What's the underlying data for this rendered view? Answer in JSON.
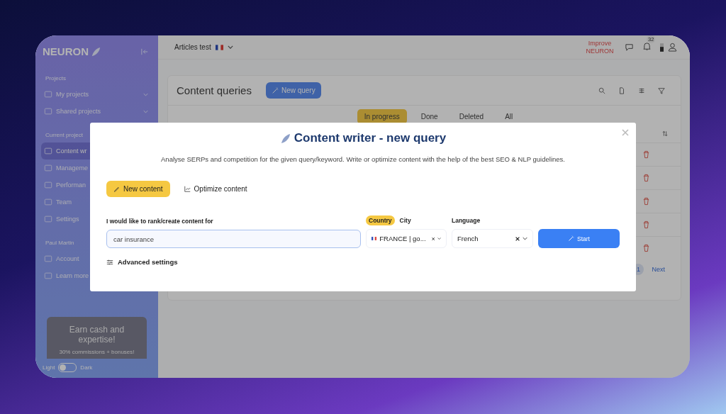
{
  "sidebar": {
    "logo": "NEURON",
    "sections": [
      {
        "title": "Projects",
        "items": [
          {
            "label": "My projects",
            "expandable": true,
            "selected": false
          },
          {
            "label": "Shared projects",
            "expandable": true,
            "selected": false
          }
        ]
      },
      {
        "title": "Current project",
        "items": [
          {
            "label": "Content wr",
            "selected": true
          },
          {
            "label": "Manageme",
            "selected": false
          },
          {
            "label": "Performan",
            "selected": false
          },
          {
            "label": "Team",
            "selected": false
          },
          {
            "label": "Settings",
            "selected": false
          }
        ]
      },
      {
        "title": "Paul Martin",
        "items": [
          {
            "label": "Account",
            "selected": false
          },
          {
            "label": "Learn more",
            "selected": false
          }
        ]
      }
    ],
    "promo": {
      "title": "Earn cash and expertise!",
      "subtitle": "30% commissions + bonuses!"
    },
    "theme": {
      "light": "Light",
      "dark": "Dark",
      "dark_on": false
    }
  },
  "topbar": {
    "project": "Articles test",
    "improve": "Improve NEURON",
    "notifications": "32"
  },
  "page": {
    "title": "Content queries",
    "new_button": "New query",
    "filters": [
      {
        "label": "In progress",
        "selected": true
      },
      {
        "label": "Done",
        "selected": false
      },
      {
        "label": "Deleted",
        "selected": false
      },
      {
        "label": "All",
        "selected": false
      }
    ],
    "pagination": {
      "pages": [
        {
          "label": "1",
          "selected": true
        }
      ],
      "next": "Next"
    }
  },
  "modal": {
    "title": "Content writer - new query",
    "description": "Analyse SERPs and competition for the given query/keyword. Write or optimize content with the help of the best SEO & NLP guidelines.",
    "modes": [
      {
        "label": "New content",
        "selected": true
      },
      {
        "label": "Optimize content",
        "selected": false
      }
    ],
    "query_label": "I would like to rank/create content for",
    "query_value": "car insurance",
    "location_tabs": [
      {
        "label": "Country",
        "selected": true
      },
      {
        "label": "City",
        "selected": false
      }
    ],
    "location_value": "FRANCE | go...",
    "language_label": "Language",
    "language_value": "French",
    "start": "Start",
    "advanced": "Advanced settings"
  }
}
